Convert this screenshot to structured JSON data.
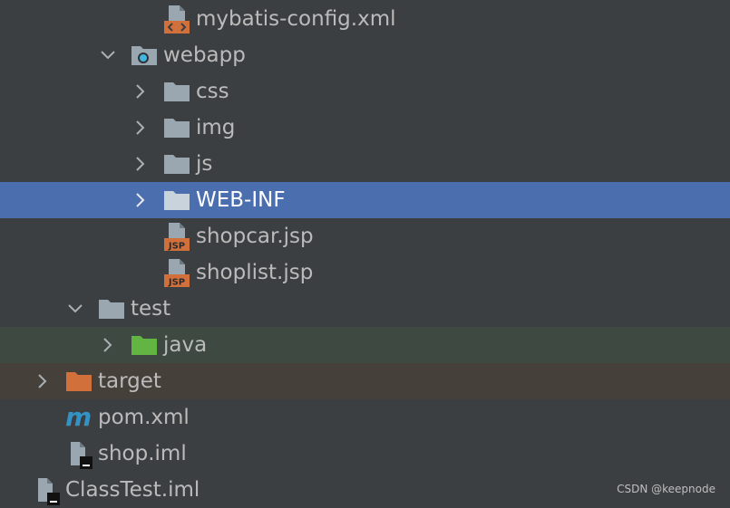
{
  "tree": {
    "items": [
      {
        "label": "mybatis-config.xml",
        "icon": "xml-file-icon"
      },
      {
        "label": "webapp",
        "icon": "web-folder-icon",
        "expanded": true
      },
      {
        "label": "css",
        "icon": "folder-icon",
        "expanded": false
      },
      {
        "label": "img",
        "icon": "folder-icon",
        "expanded": false
      },
      {
        "label": "js",
        "icon": "folder-icon",
        "expanded": false
      },
      {
        "label": "WEB-INF",
        "icon": "folder-icon",
        "expanded": false,
        "selected": true
      },
      {
        "label": "shopcar.jsp",
        "icon": "jsp-file-icon"
      },
      {
        "label": "shoplist.jsp",
        "icon": "jsp-file-icon"
      },
      {
        "label": "test",
        "icon": "folder-icon",
        "expanded": true
      },
      {
        "label": "java",
        "icon": "test-source-folder-icon",
        "expanded": false
      },
      {
        "label": "target",
        "icon": "excluded-folder-icon",
        "expanded": false
      },
      {
        "label": "pom.xml",
        "icon": "maven-file-icon"
      },
      {
        "label": "shop.iml",
        "icon": "iml-file-icon"
      },
      {
        "label": "ClassTest.iml",
        "icon": "iml-file-icon"
      }
    ]
  },
  "watermark": "CSDN @keepnode",
  "colors": {
    "background": "#3c3f41",
    "selection": "#4b6eaf",
    "test_row": "#3e4a41",
    "excluded_row": "#45403a",
    "folder": "#9aa7b0",
    "test_folder": "#62b543",
    "excluded_folder": "#d2703b",
    "maven": "#3592c4"
  }
}
